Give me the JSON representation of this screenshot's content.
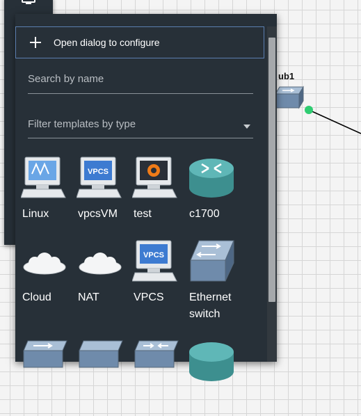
{
  "canvas": {
    "node_label": "ub1"
  },
  "panel": {
    "configure_label": "Open dialog to configure",
    "search_placeholder": "Search by name",
    "filter_placeholder": "Filter templates by type",
    "templates": [
      {
        "label": "Linux",
        "icon": "linux-computer-icon"
      },
      {
        "label": "vpcsVM",
        "icon": "vpcs-computer-icon"
      },
      {
        "label": "test",
        "icon": "qemu-computer-icon"
      },
      {
        "label": "c1700",
        "icon": "router-icon"
      },
      {
        "label": "Cloud",
        "icon": "cloud-icon"
      },
      {
        "label": "NAT",
        "icon": "nat-cloud-icon"
      },
      {
        "label": "VPCS",
        "icon": "vpcs-computer-icon"
      },
      {
        "label": "Ethernet switch",
        "icon": "ethernet-switch-icon"
      },
      {
        "label": "",
        "icon": "switch-icon"
      },
      {
        "label": "",
        "icon": "hub-icon"
      },
      {
        "label": "",
        "icon": "switch-icon"
      },
      {
        "label": "",
        "icon": "router-icon"
      }
    ]
  },
  "colors": {
    "panel_bg": "#273038",
    "accent_border": "#5b7fb0",
    "link_dot": "#2ecc71"
  }
}
